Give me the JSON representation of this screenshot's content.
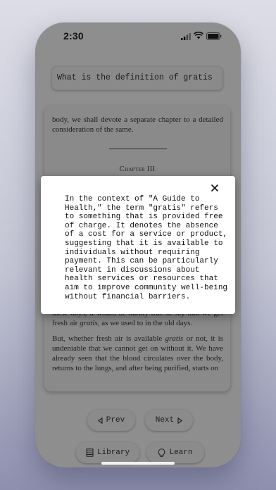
{
  "status_bar": {
    "time": "2:30"
  },
  "search": {
    "query": "What is the definition of gratis"
  },
  "reader": {
    "para_top": "body, we shall devote a separate chapter to a detailed consideration of the same.",
    "chapter_heading": "Chapter III",
    "para_mid": "these days, it would be hardly true to say that we get fresh air gratis, as we used to in the old days.",
    "para_bottom": "But, whether fresh air is available gratis or not, it is undeniable that we cannot get on without it. We have already seen that the blood circulates over the body, returns to the lungs, and after being purified, starts on"
  },
  "modal": {
    "close_symbol": "×",
    "text": "In the context of \"A Guide to\nHealth,\" the term \"gratis\" refers\nto something that is provided free\nof charge. It denotes the absence\nof a cost for a service or product,\nsuggesting that it is available to\nindividuals without requiring\npayment. This can be particularly\nrelevant in discussions about\nhealth services or resources that\naim to improve community well-being\nwithout financial barriers."
  },
  "nav": {
    "prev_label": "Prev",
    "next_label": "Next"
  },
  "bottom_bar": {
    "library_label": "Library",
    "learn_label": "Learn"
  },
  "icons": {
    "signal": "signal-icon",
    "wifi": "wifi-icon",
    "battery": "battery-icon",
    "close": "close-icon",
    "prev": "triangle-left-icon",
    "next": "triangle-right-icon",
    "library": "book-icon",
    "learn": "lightbulb-icon"
  }
}
